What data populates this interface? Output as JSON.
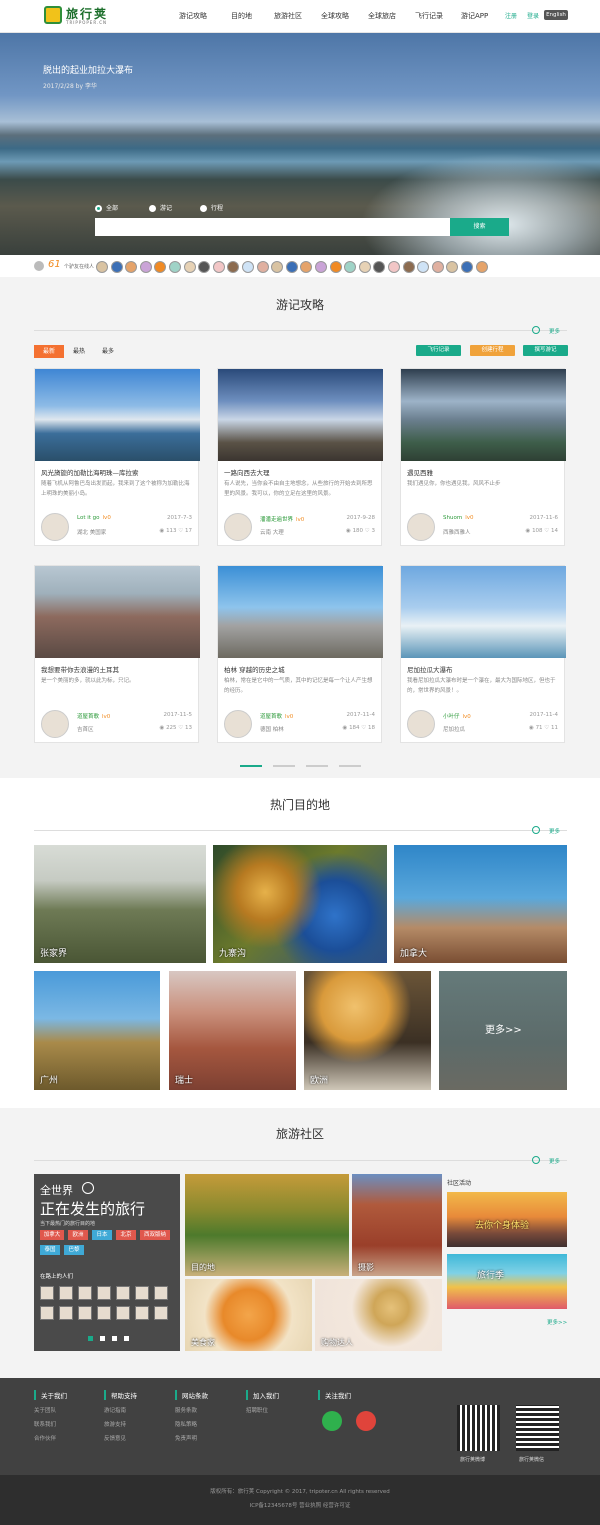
{
  "header": {
    "logo_text": "旅行荚",
    "logo_sub": "TRIPPOPER.CN",
    "nav": [
      "游记攻略",
      "目的地",
      "旅游社区",
      "全球攻略",
      "全球旅店",
      "飞行记录",
      "游记APP"
    ],
    "login": "注册",
    "register": "登录",
    "lang": "English"
  },
  "hero": {
    "title": "脱出的起业加拉大瀑布",
    "date": "2017/2/28 by 李华",
    "radios": [
      "全部",
      "游记",
      "行程"
    ],
    "search_button": "搜索"
  },
  "online": {
    "count": "61",
    "label": "个驴友在线人"
  },
  "travel": {
    "title": "游记攻略",
    "more": "更多",
    "tabs": [
      "最新",
      "最热",
      "最多"
    ],
    "buttons": [
      "飞行记录",
      "创建行程",
      "撰写游记"
    ],
    "cards": [
      {
        "title": "风光旖旎的加勒比海明珠—库拉索",
        "desc": "随着飞机从阿鲁巴岛出发而起，我来到了这个被称为加勒比海上明珠的美丽小岛。",
        "user": "Lot it go",
        "level": "lv0",
        "loc": "湖北 美国家",
        "date": "2017-7-3",
        "views": "113",
        "likes": "17"
      },
      {
        "title": "一路向西去大理",
        "desc": "有人说先，当你会不由自主地想念，从些旅行的开始去到所思里的风景。我可以，你的立足在这里的风景。",
        "user": "潘潘走遍世界",
        "level": "lv0",
        "loc": "云南 大理",
        "date": "2017-9-28",
        "views": "180",
        "likes": "3"
      },
      {
        "title": "遇见西雅",
        "desc": "我们遇见你，你也遇见我，风风不止步",
        "user": "Shuom",
        "level": "lv0",
        "loc": "西雅西雅人",
        "date": "2017-11-6",
        "views": "108",
        "likes": "14"
      },
      {
        "title": "我想要带你去浪漫的土耳其",
        "desc": "是一个美丽的多，就以此为标，只记。",
        "user": "道屋首歌",
        "level": "lv0",
        "loc": "吉首区",
        "date": "2017-11-5",
        "views": "225",
        "likes": "13"
      },
      {
        "title": "柏林 穿越的历史之城",
        "desc": "柏林，常在是它中的一气质，其中的记忆是每一个让人产生想的经历。",
        "user": "道屋首歌",
        "level": "lv0",
        "loc": "德国 柏林",
        "date": "2017-11-4",
        "views": "184",
        "likes": "18"
      },
      {
        "title": "尼加拉瓜大瀑布",
        "desc": "我看尼加拉瓜大瀑布时是一个瀑在，最大为国际地区，但也于的，常世界的风景！。",
        "user": "小叶仔",
        "level": "lv0",
        "loc": "尼加拉瓜",
        "date": "2017-11-4",
        "views": "71",
        "likes": "11"
      }
    ]
  },
  "dest": {
    "title": "热门目的地",
    "more": "更多",
    "items": [
      "张家界",
      "九寨沟",
      "加拿大",
      "广州",
      "瑞士",
      "欧洲"
    ],
    "more_label": "更多>>"
  },
  "community": {
    "title": "旅游社区",
    "more": "更多",
    "box_t1": "全世界",
    "box_t2": "正在发生的旅行",
    "box_t3": "当下最热门的旅行目的地",
    "tags": [
      "加拿大",
      "欧洲",
      "日本",
      "北京",
      "西双版纳",
      "泰国",
      "巴黎"
    ],
    "people_label": "在路上的人们",
    "images": [
      "目的地",
      "摄影",
      "美食家",
      "购物达人"
    ],
    "act_title": "社区活动",
    "act_more": "更多>>",
    "act_banners": [
      "去你个身体验",
      "旅行季"
    ]
  },
  "footer": {
    "cols": [
      {
        "head": "关于我们",
        "links": [
          "关于团队",
          "联系我们",
          "合作伙伴"
        ]
      },
      {
        "head": "帮助支持",
        "links": [
          "游记指南",
          "旅游支持",
          "反馈意见"
        ]
      },
      {
        "head": "网站条款",
        "links": [
          "服务条款",
          "隐私策略",
          "免责声明"
        ]
      },
      {
        "head": "加入我们",
        "links": [
          "招聘职位"
        ]
      },
      {
        "head": "关注我们",
        "links": []
      }
    ],
    "qr_captions": [
      "旅行荚微博",
      "旅行荚微信"
    ],
    "copyright": "版权所有：旅行荚 Copyright © 2017, tripoter.cn All rights reserved",
    "icp": "ICP备12345678号   营业执照   经营许可证"
  },
  "colors": {
    "accent": "#1aaa8a",
    "orange": "#f47131",
    "footer": "#414141"
  }
}
